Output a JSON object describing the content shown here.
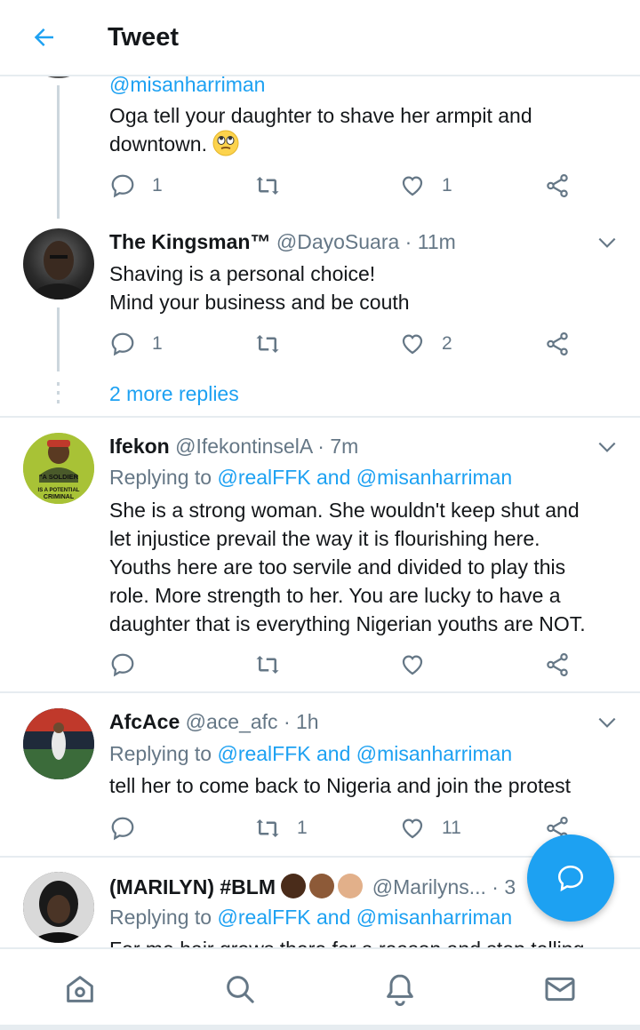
{
  "header": {
    "title": "Tweet"
  },
  "tweets": [
    {
      "mention": "@misanharriman",
      "text_line1": "Oga tell your daughter to shave her armpit and",
      "text_line2": "downtown.",
      "reply_count": "1",
      "retweet_count": "",
      "like_count": "1"
    },
    {
      "name": "The Kingsman™",
      "handle": "@DayoSuara",
      "sep": "·",
      "time": "11m",
      "text_line1": "Shaving is a personal choice!",
      "text_line2": "Mind your business and be couth",
      "reply_count": "1",
      "retweet_count": "",
      "like_count": "2",
      "more_replies": "2 more replies"
    },
    {
      "name": "Ifekon",
      "handle": "@IfekontinselA",
      "sep": "·",
      "time": "7m",
      "replying_prefix": "Replying to",
      "replying_to": "@realFFK and @misanharriman",
      "text_lines": [
        "She is a strong woman. She wouldn't keep shut and",
        "let injustice prevail the way it is flourishing here.",
        "Youths here are too servile and divided to play this",
        "role. More strength to her. You are lucky to have a",
        "daughter that is everything Nigerian youths are NOT."
      ],
      "avatar_text_1": "\"A SOLDIER",
      "avatar_text_2": "IS A POTENTIAL",
      "avatar_text_3": "CRIMINAL"
    },
    {
      "name": "AfcAce",
      "handle": "@ace_afc",
      "sep": "·",
      "time": "1h",
      "replying_prefix": "Replying to",
      "replying_to": "@realFFK and @misanharriman",
      "text_line1": "tell her to come back to Nigeria and join the protest",
      "reply_count": "",
      "retweet_count": "1",
      "like_count": "11"
    },
    {
      "name": "(MARILYN) #BLM",
      "handle": "@Marilyns...",
      "sep": "·",
      "time": "3",
      "replying_prefix": "Replying to",
      "replying_to": "@realFFK and @misanharriman",
      "text_line1": "For me hair grows there for a reason and stop telling"
    }
  ],
  "colors": {
    "accent": "#1da1f2",
    "secondary_text": "#657786",
    "divider": "#e6ecf0",
    "thread_line": "#ccd6dd"
  },
  "tabs": [
    "home-icon",
    "search-icon",
    "notifications-icon",
    "messages-icon"
  ]
}
